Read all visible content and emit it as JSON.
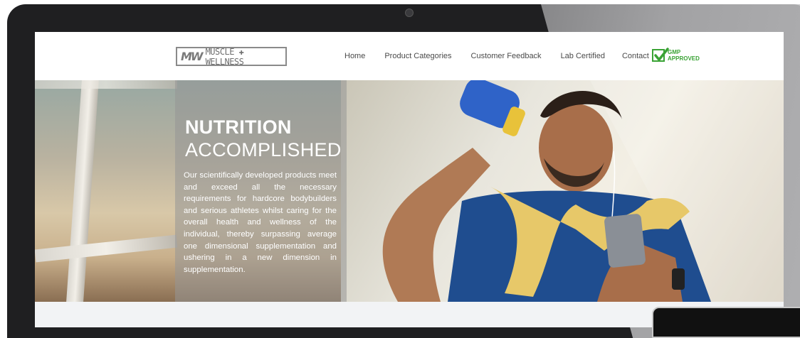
{
  "header": {
    "logo_mark": "MW",
    "logo_text": "MUSCLE ✚ WELLNESS",
    "nav": [
      "Home",
      "Product Categories",
      "Customer Feedback",
      "Lab Certified",
      "Contact"
    ],
    "badge_line1": "GMP",
    "badge_line2": "APPROVED"
  },
  "hero": {
    "title_line1": "NUTRITION",
    "title_line2": "ACCOMPLISHED",
    "body": "Our scientifically developed products meet and exceed all the necessary requirements for hardcore bodybuilders and serious athletes whilst caring for the overall health and wellness of the individual, thereby surpassing average one dimensional supplementation and ushering in a new dimension in supplementation."
  },
  "colors": {
    "accent_green": "#3aa335",
    "frame": "#1f1f21"
  }
}
